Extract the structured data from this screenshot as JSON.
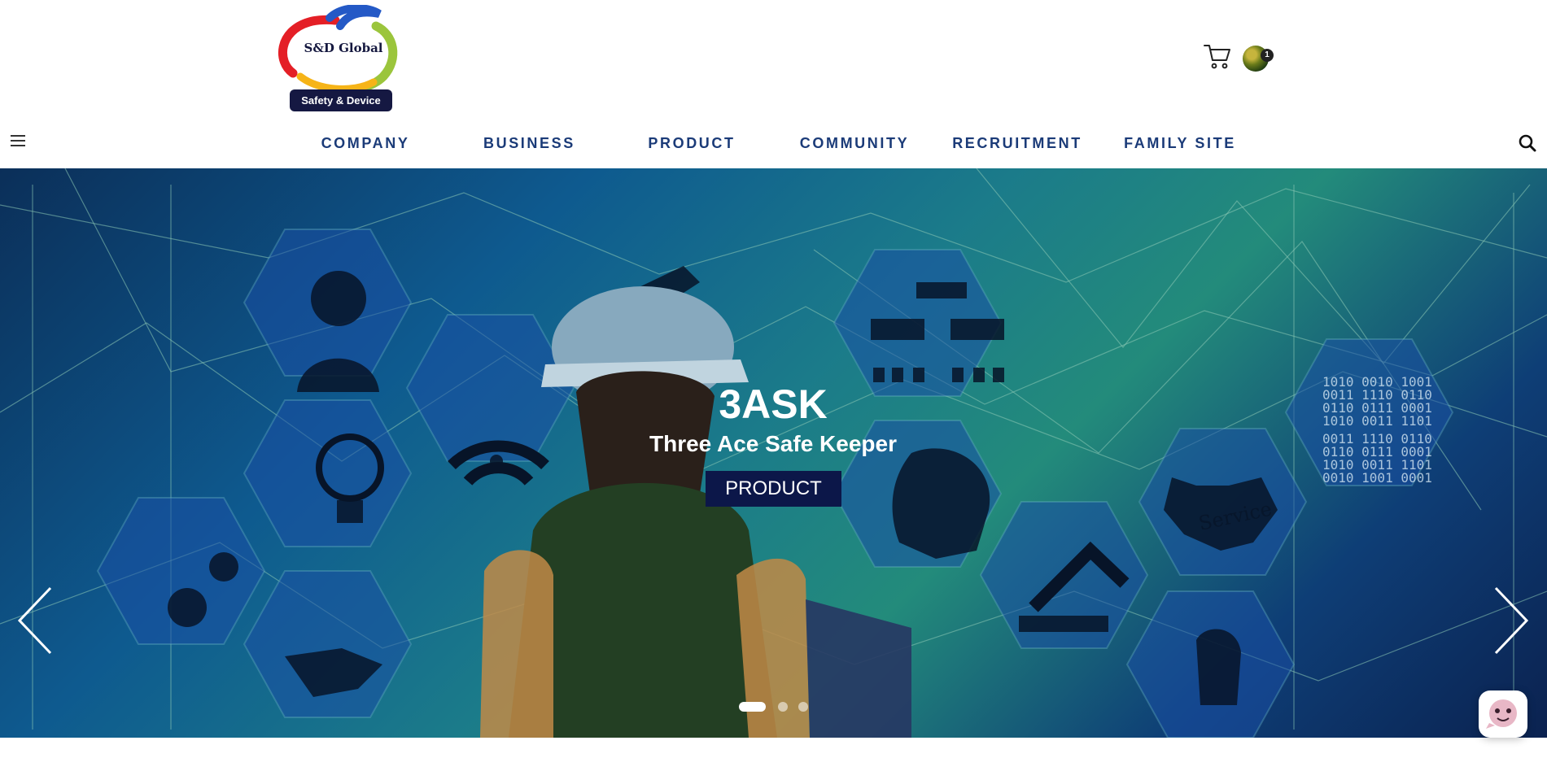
{
  "logo": {
    "name": "S&D Global",
    "tagline": "Safety & Device"
  },
  "header": {
    "cart_icon": "cart-icon",
    "avatar_badge": "1"
  },
  "nav": {
    "items": [
      {
        "label": "COMPANY"
      },
      {
        "label": "BUSINESS"
      },
      {
        "label": "PRODUCT"
      },
      {
        "label": "COMMUNITY"
      },
      {
        "label": "RECRUITMENT"
      },
      {
        "label": "FAMILY SITE"
      }
    ]
  },
  "hero": {
    "title": "3ASK",
    "subtitle": "Three Ace Safe Keeper",
    "button_label": "PRODUCT",
    "slide_index": 1,
    "slide_count": 3
  },
  "icons": [
    "menu-icon",
    "search-icon",
    "arrow-left-icon",
    "arrow-right-icon",
    "chat-icon"
  ],
  "colors": {
    "nav_text": "#1b3b78",
    "button_bg": "#0c1749",
    "logo_badge_bg": "#151842"
  }
}
